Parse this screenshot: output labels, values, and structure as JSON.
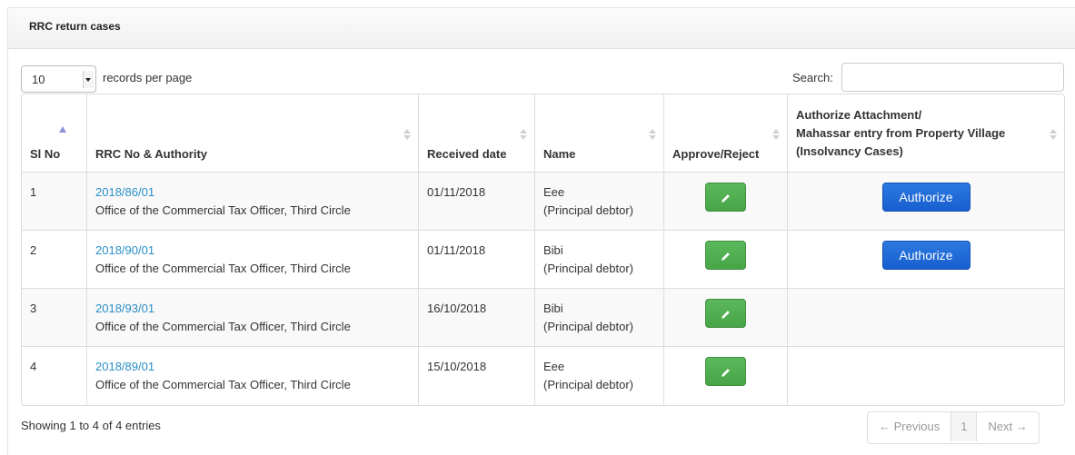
{
  "panel": {
    "title": "RRC return cases"
  },
  "length_menu": {
    "value": "10",
    "suffix": "records per page"
  },
  "search": {
    "label": "Search:",
    "value": ""
  },
  "table": {
    "headers": {
      "sl_no": "Sl No",
      "rrc": "RRC No & Authority",
      "received": "Received date",
      "name": "Name",
      "approve": "Approve/Reject",
      "authorize_line1": "Authorize Attachment/",
      "authorize_line2": "Mahassar entry from Property Village",
      "authorize_line3": "(Insolvancy Cases)"
    },
    "rows": [
      {
        "sl": "1",
        "rrc_no": "2018/86/01",
        "authority": "Office of the Commercial Tax Officer, Third Circle",
        "date": "01/11/2018",
        "name": "Eee",
        "role": "(Principal debtor)",
        "authorize": "Authorize"
      },
      {
        "sl": "2",
        "rrc_no": "2018/90/01",
        "authority": "Office of the Commercial Tax Officer, Third Circle",
        "date": "01/11/2018",
        "name": "Bibi",
        "role": "(Principal debtor)",
        "authorize": "Authorize"
      },
      {
        "sl": "3",
        "rrc_no": "2018/93/01",
        "authority": "Office of the Commercial Tax Officer, Third Circle",
        "date": "16/10/2018",
        "name": "Bibi",
        "role": "(Principal debtor)",
        "authorize": ""
      },
      {
        "sl": "4",
        "rrc_no": "2018/89/01",
        "authority": "Office of the Commercial Tax Officer, Third Circle",
        "date": "15/10/2018",
        "name": "Eee",
        "role": "(Principal debtor)",
        "authorize": ""
      }
    ]
  },
  "footer": {
    "info": "Showing 1 to 4 of 4 entries",
    "prev": "← Previous",
    "page": "1",
    "next": "Next →"
  },
  "icons": {
    "approve": "pencil-icon",
    "sort": "sort-icon",
    "sort_asc": "sort-asc-icon"
  },
  "colors": {
    "link": "#2a8ec7",
    "approve": "#5cb85c",
    "authorize": "#1f6fd8"
  }
}
